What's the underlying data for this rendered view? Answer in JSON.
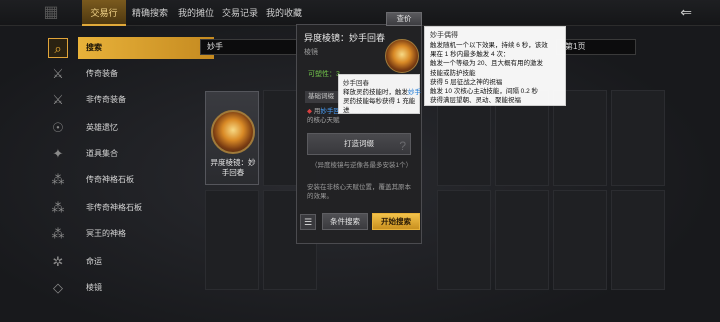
{
  "header": {
    "tabs": [
      {
        "label": "交易行",
        "active": true
      },
      {
        "label": "精确搜索",
        "active": false
      },
      {
        "label": "我的摊位",
        "active": false
      },
      {
        "label": "交易记录",
        "active": false
      },
      {
        "label": "我的收藏",
        "active": false
      }
    ],
    "logo_icon": "game-logo-icon",
    "back_icon": "back-arrow-icon"
  },
  "sidebar": {
    "items": [
      {
        "label": "搜索",
        "icon": "search-icon",
        "active": true
      },
      {
        "label": "传奇装备",
        "icon": "legendary-gear-icon",
        "active": false
      },
      {
        "label": "非传奇装备",
        "icon": "gear-icon",
        "active": false
      },
      {
        "label": "英雄遗忆",
        "icon": "hero-memory-icon",
        "active": false
      },
      {
        "label": "道具集合",
        "icon": "items-icon",
        "active": false
      },
      {
        "label": "传奇神格石板",
        "icon": "slate-icon",
        "active": false
      },
      {
        "label": "非传奇神格石板",
        "icon": "slate-icon",
        "active": false
      },
      {
        "label": "冥王的神格",
        "icon": "pluto-icon",
        "active": false
      },
      {
        "label": "命运",
        "icon": "destiny-icon",
        "active": false
      },
      {
        "label": "棱镜",
        "icon": "prism-icon",
        "active": false
      }
    ]
  },
  "search": {
    "value": "妙手",
    "page": "第1页"
  },
  "grid_item": {
    "name": "异度棱镜：妙手回春",
    "icon": "prism-item-icon"
  },
  "tooltip": {
    "title": "异度棱镜：妙手回春",
    "type": "棱镜",
    "plasticity": "可塑性：3",
    "section": "基础词缀",
    "desc_prefix": "用",
    "desc_link": "妙手回春",
    "desc_suffix": "替换基础异能天赋板的核心天赋",
    "forge_button": "打造词缀",
    "note": "（异度棱镜与逆像各最多安装1个）",
    "note2": "安装在非核心天赋位置，覆盖其原本的效果。",
    "price_button": "查价"
  },
  "popup_small": {
    "title": "妙手回春",
    "body_prefix": "释放灵药技能时，触发",
    "body_link": "妙手",
    "body_suffix": "灵药技能每秒获得 1 充能进"
  },
  "popup_large": {
    "title": "妙手偶得",
    "lines": [
      "触发随机一个以下效果，持续 6 秒，该效",
      "果在 1 秒内最多触发 4 次：",
      "触发一个等级为 20、且大概有用的激发",
      "技能或防护技能",
      "获得 5 层征战之神的祝福",
      "触发 10 次核心主动技能，间隔 0.2 秒",
      "获得满层望朝、灵动、聚能祝福"
    ]
  },
  "buttons": {
    "menu_icon": "menu-icon",
    "condition_search": "条件搜索",
    "start_search": "开始搜索"
  },
  "colors": {
    "accent": "#e8b23a",
    "link": "#1a78d6",
    "plasticity": "#6fbf4a"
  }
}
